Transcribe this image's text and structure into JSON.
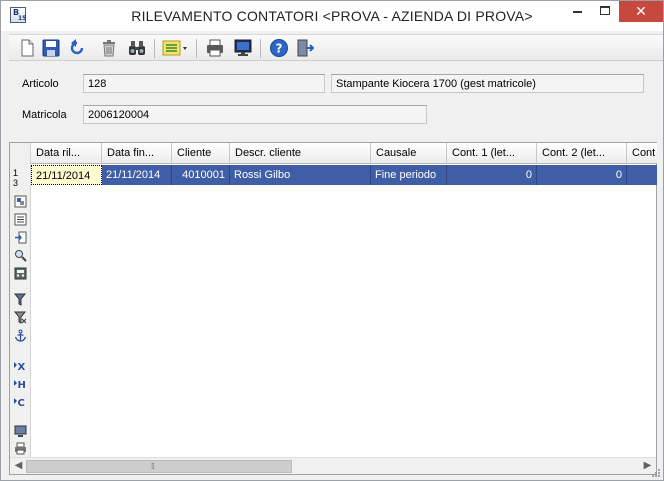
{
  "window": {
    "title": "RILEVAMENTO CONTATORI <PROVA - AZIENDA DI PROVA>",
    "app_icon_text": "B",
    "app_icon_sub": "15",
    "close_label": "✕"
  },
  "toolbar": {
    "buttons": [
      "new-document-icon",
      "save-icon",
      "undo-icon",
      "delete-icon",
      "find-icon",
      "list-options-icon",
      "print-icon",
      "preview-monitor-icon",
      "help-icon",
      "exit-icon"
    ]
  },
  "form": {
    "articolo_label": "Articolo",
    "articolo_value": "128",
    "articolo_desc": "Stampante Kiocera 1700  (gest matricole)",
    "matricola_label": "Matricola",
    "matricola_value": "2006120004"
  },
  "grid": {
    "columns": [
      "Data ril...",
      "Data fin...",
      "Cliente",
      "Descr. cliente",
      "Causale",
      "Cont. 1 (let...",
      "Cont. 2 (let...",
      "Cont"
    ],
    "rows": [
      {
        "data_ril": "21/11/2014",
        "data_fin": "21/11/2014",
        "cliente": "4010001",
        "descr_cliente": "Rossi Gilbo",
        "causale": "Fine periodo",
        "cont1": "0",
        "cont2": "0",
        "cont3": ""
      }
    ],
    "row_number": "1",
    "row_count": "3",
    "side_icons": [
      "grid-layout-icon",
      "list-icon",
      "export-icon",
      "zoom-icon",
      "calc-icon",
      "filter-icon",
      "filter-remove-icon",
      "anchor-icon",
      "export-excel-icon",
      "export-html-icon",
      "export-csv-icon",
      "monitor-icon",
      "print-icon"
    ]
  },
  "scrollbar": {
    "left_arrow": "◀",
    "right_arrow": "▶",
    "grip": "⁞⁞"
  },
  "colors": {
    "selected_row": "#3f5ea6",
    "active_cell": "#fffbd0",
    "close_button": "#c7493d"
  }
}
